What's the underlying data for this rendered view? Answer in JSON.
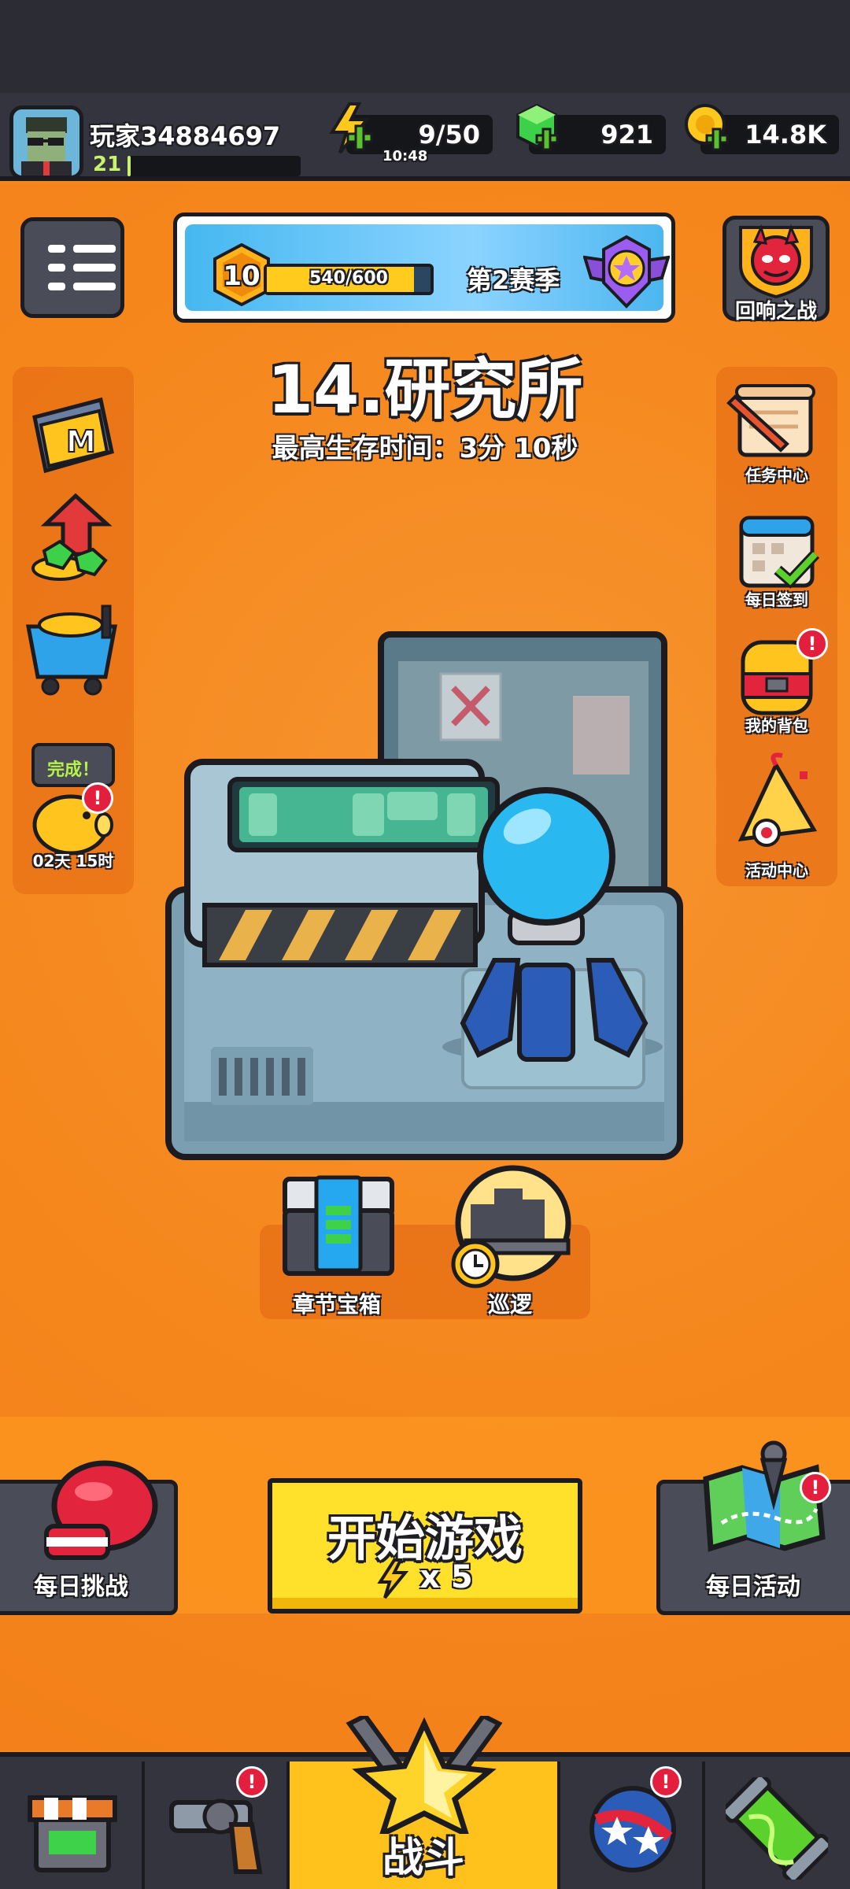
{
  "player": {
    "name": "玩家34884697",
    "level": "21",
    "xp_fraction": 0.02
  },
  "resources": {
    "energy": {
      "value": "9/50",
      "timer": "10:48",
      "icon": "lightning-icon"
    },
    "gems": {
      "value": "921",
      "icon": "green-gem-icon"
    },
    "coins": {
      "value": "14.8K",
      "icon": "gold-coin-icon"
    }
  },
  "season": {
    "level": "10",
    "progress_text": "540/600",
    "progress_fraction": 0.9,
    "name": "第2赛季"
  },
  "echo_battle": {
    "label": "回响之战"
  },
  "stage": {
    "title": "14.研究所",
    "best_time": "最高生存时间：3分 10秒"
  },
  "left_side": {
    "piggy_done": "完成！",
    "piggy_timer": "02天 15时"
  },
  "right_side": {
    "items": [
      {
        "label": "任务中心"
      },
      {
        "label": "每日签到"
      },
      {
        "label": "我的背包"
      },
      {
        "label": "活动中心"
      }
    ]
  },
  "chest": {
    "label": "章节宝箱"
  },
  "patrol": {
    "label": "巡逻"
  },
  "actions": {
    "daily_challenge": "每日挑战",
    "start_game": "开始游戏",
    "start_cost": "x 5",
    "daily_event": "每日活动"
  },
  "nav": {
    "battle_label": "战斗"
  },
  "alert_mark": "!",
  "colors": {
    "accent_yellow": "#ffe02a",
    "bg_orange": "#f5871c",
    "panel_dark": "#33343d",
    "alert_red": "#e41f3e"
  }
}
